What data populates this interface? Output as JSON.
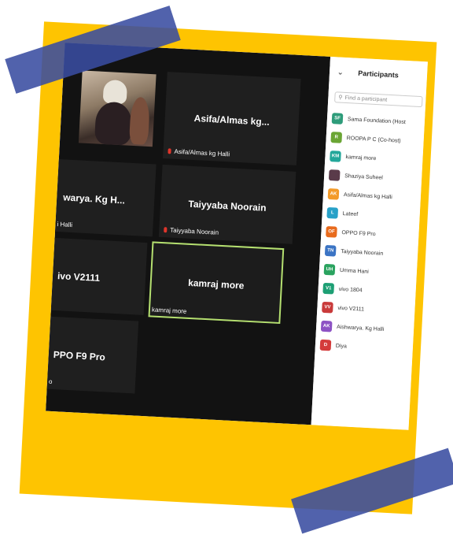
{
  "panel": {
    "title": "Participants",
    "search_placeholder": "Find a participant",
    "participants": [
      {
        "initials": "SF",
        "name": "Sama Foundation (Host",
        "color": "#2e9c7a"
      },
      {
        "initials": "R",
        "name": "ROOPA P C (Co-host)",
        "color": "#6aa534"
      },
      {
        "initials": "KM",
        "name": "kamraj more",
        "color": "#23a79a"
      },
      {
        "initials": "",
        "name": "Shaziya Suheel",
        "color": "#5a3b4a"
      },
      {
        "initials": "AK",
        "name": "Asifa/Almas kg Halli",
        "color": "#f39a28"
      },
      {
        "initials": "L",
        "name": "Lateef",
        "color": "#28a1c8"
      },
      {
        "initials": "OF",
        "name": "OPPO F9 Pro",
        "color": "#e86b1d"
      },
      {
        "initials": "TN",
        "name": "Taiyyaba Noorain",
        "color": "#3b74c4"
      },
      {
        "initials": "UH",
        "name": "Umma Hani",
        "color": "#2aa35f"
      },
      {
        "initials": "V1",
        "name": "vivo 1804",
        "color": "#1d9f74"
      },
      {
        "initials": "VV",
        "name": "vivo V2111",
        "color": "#c93a3a"
      },
      {
        "initials": "AK",
        "name": "Aishwarya. Kg Halli",
        "color": "#8d52c4"
      },
      {
        "initials": "D",
        "name": "Diya",
        "color": "#d43b3b"
      }
    ]
  },
  "tiles": {
    "asifa": {
      "name": "Asifa/Almas  kg...",
      "caption": "Asifa/Almas kg Halli"
    },
    "aishwarya": {
      "name": "warya. Kg H...",
      "caption": "i Halli"
    },
    "taiyyaba": {
      "name": "Taiyyaba Noorain",
      "caption": "Taiyyaba Noorain"
    },
    "vivo": {
      "name": "ivo V2111"
    },
    "kamraj": {
      "name": "kamraj more",
      "caption": "kamraj more"
    },
    "oppo": {
      "name": "PPO F9 Pro",
      "caption": "o"
    }
  },
  "colors": {
    "frame": "#fec401",
    "tape": "#394ca0",
    "active_border": "#b5e070"
  }
}
